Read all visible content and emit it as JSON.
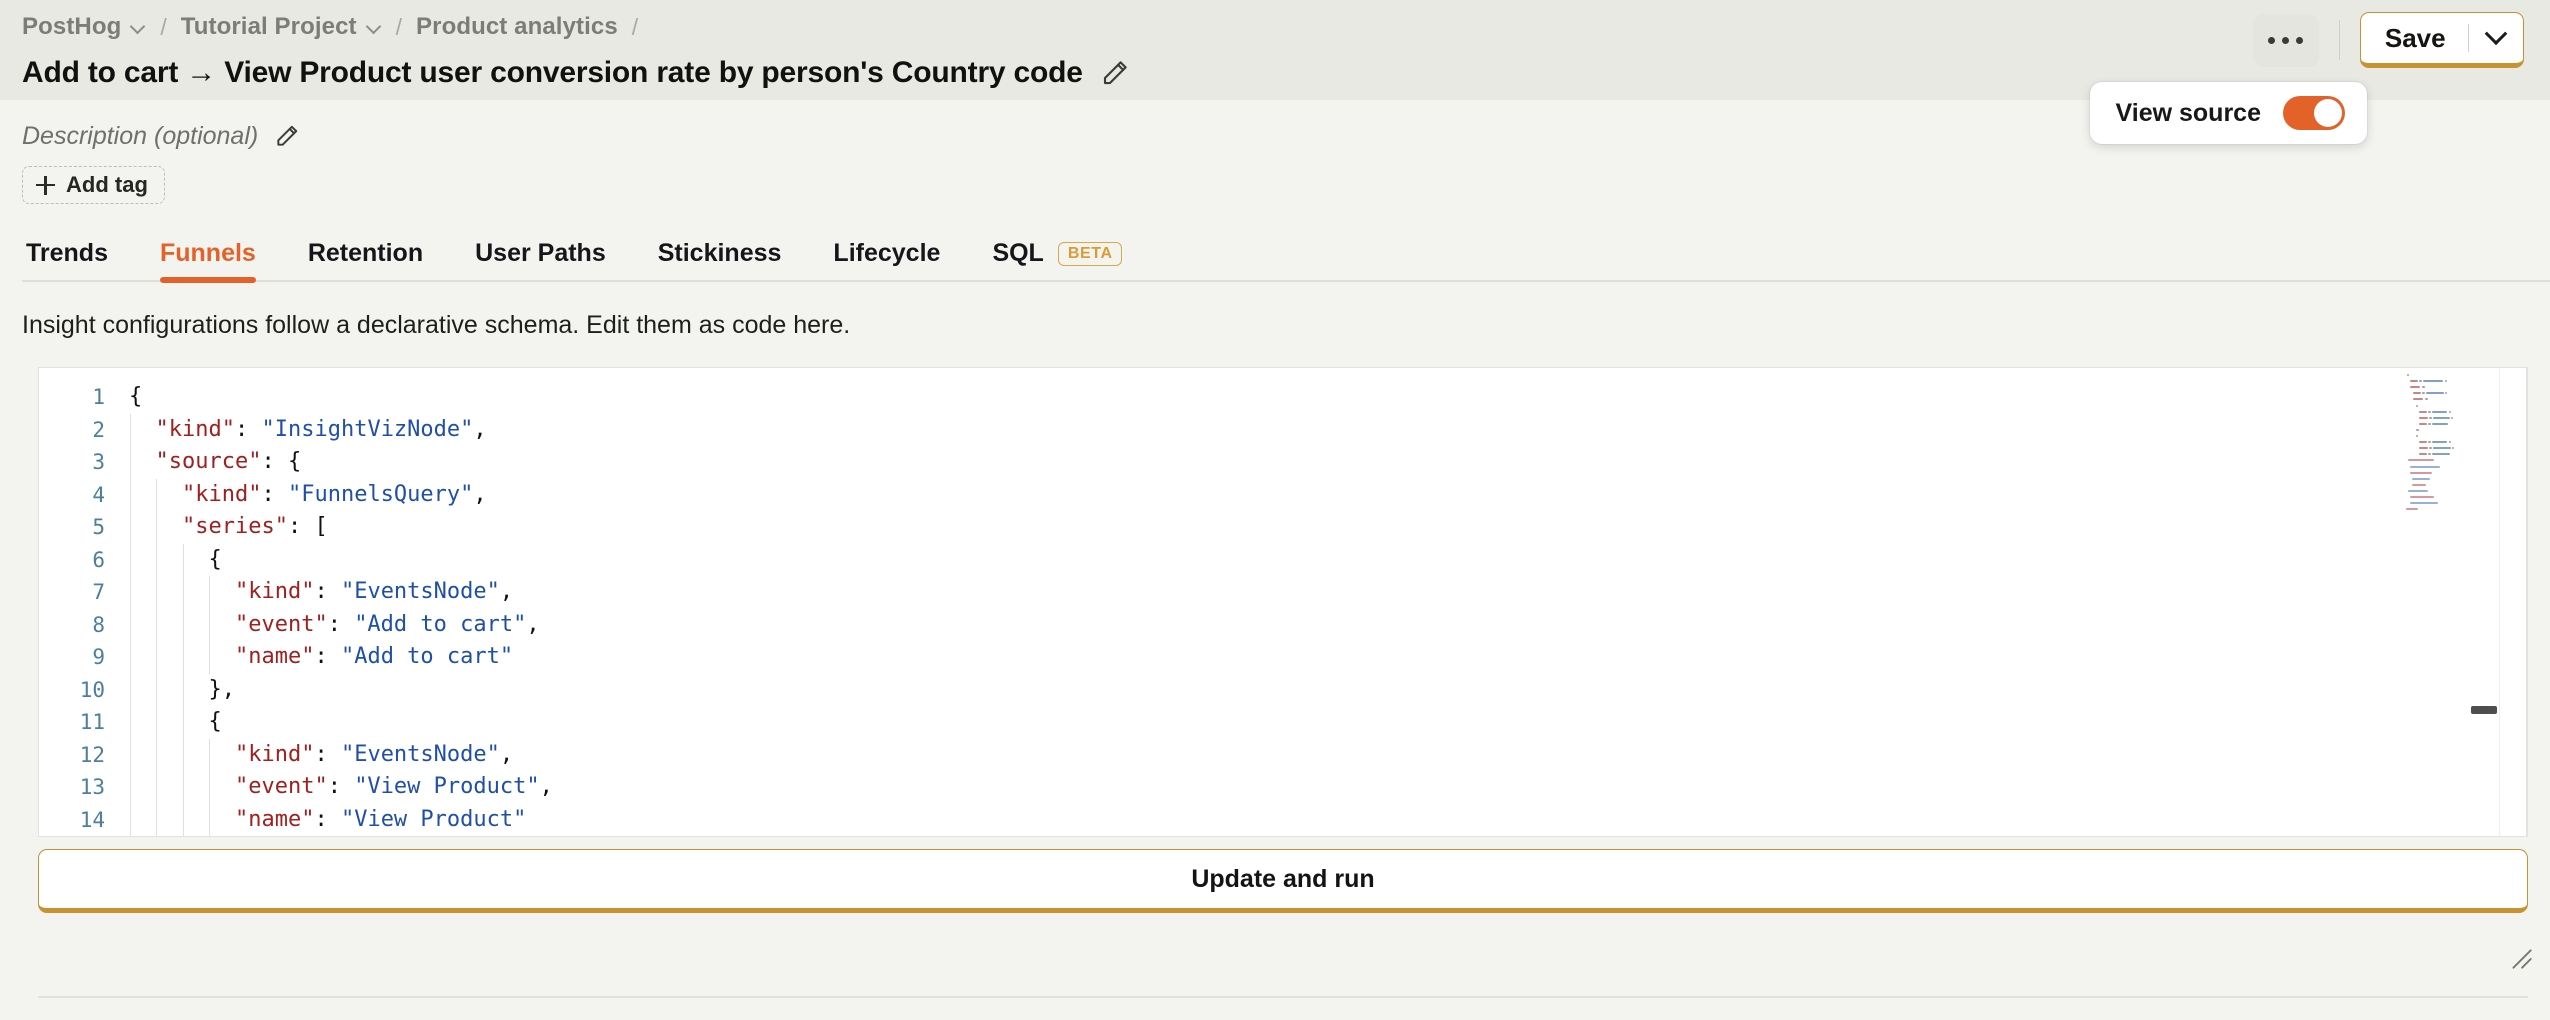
{
  "header": {
    "breadcrumb": [
      {
        "label": "PostHog",
        "has_chevron": true
      },
      {
        "label": "Tutorial Project",
        "has_chevron": true
      },
      {
        "label": "Product analytics",
        "has_chevron": false
      }
    ],
    "separator": "/",
    "title": "Add to cart → View Product user conversion rate by person's Country code",
    "edit_title_icon": "pencil-icon",
    "more_menu_icon": "ellipsis-icon",
    "save_label": "Save",
    "save_caret_icon": "chevron-down-icon"
  },
  "view_source_popover": {
    "label": "View source",
    "toggle_on": true,
    "accent": "#e3622a"
  },
  "meta": {
    "description_placeholder": "Description (optional)",
    "description_edit_icon": "pencil-icon",
    "add_tag_label": "Add tag",
    "add_tag_icon": "plus-icon"
  },
  "tabs": [
    {
      "label": "Trends",
      "active": false,
      "badge": null
    },
    {
      "label": "Funnels",
      "active": true,
      "badge": null
    },
    {
      "label": "Retention",
      "active": false,
      "badge": null
    },
    {
      "label": "User Paths",
      "active": false,
      "badge": null
    },
    {
      "label": "Stickiness",
      "active": false,
      "badge": null
    },
    {
      "label": "Lifecycle",
      "active": false,
      "badge": null
    },
    {
      "label": "SQL",
      "active": false,
      "badge": "BETA"
    }
  ],
  "editor": {
    "hint": "Insight configurations follow a declarative schema. Edit them as code here.",
    "line_numbers": [
      1,
      2,
      3,
      4,
      5,
      6,
      7,
      8,
      9,
      10,
      11,
      12,
      13,
      14
    ],
    "lines": [
      {
        "n": 1,
        "indent": 0,
        "tokens": [
          {
            "t": "punct",
            "v": "{"
          }
        ]
      },
      {
        "n": 2,
        "indent": 1,
        "tokens": [
          {
            "t": "key",
            "v": "\"kind\""
          },
          {
            "t": "punct",
            "v": ": "
          },
          {
            "t": "str",
            "v": "\"InsightVizNode\""
          },
          {
            "t": "punct",
            "v": ","
          }
        ]
      },
      {
        "n": 3,
        "indent": 1,
        "tokens": [
          {
            "t": "key",
            "v": "\"source\""
          },
          {
            "t": "punct",
            "v": ": {"
          }
        ]
      },
      {
        "n": 4,
        "indent": 2,
        "tokens": [
          {
            "t": "key",
            "v": "\"kind\""
          },
          {
            "t": "punct",
            "v": ": "
          },
          {
            "t": "str",
            "v": "\"FunnelsQuery\""
          },
          {
            "t": "punct",
            "v": ","
          }
        ]
      },
      {
        "n": 5,
        "indent": 2,
        "tokens": [
          {
            "t": "key",
            "v": "\"series\""
          },
          {
            "t": "punct",
            "v": ": ["
          }
        ]
      },
      {
        "n": 6,
        "indent": 3,
        "tokens": [
          {
            "t": "punct",
            "v": "{"
          }
        ]
      },
      {
        "n": 7,
        "indent": 4,
        "tokens": [
          {
            "t": "key",
            "v": "\"kind\""
          },
          {
            "t": "punct",
            "v": ": "
          },
          {
            "t": "str",
            "v": "\"EventsNode\""
          },
          {
            "t": "punct",
            "v": ","
          }
        ]
      },
      {
        "n": 8,
        "indent": 4,
        "tokens": [
          {
            "t": "key",
            "v": "\"event\""
          },
          {
            "t": "punct",
            "v": ": "
          },
          {
            "t": "str",
            "v": "\"Add to cart\""
          },
          {
            "t": "punct",
            "v": ","
          }
        ]
      },
      {
        "n": 9,
        "indent": 4,
        "tokens": [
          {
            "t": "key",
            "v": "\"name\""
          },
          {
            "t": "punct",
            "v": ": "
          },
          {
            "t": "str",
            "v": "\"Add to cart\""
          }
        ]
      },
      {
        "n": 10,
        "indent": 3,
        "tokens": [
          {
            "t": "punct",
            "v": "},"
          }
        ]
      },
      {
        "n": 11,
        "indent": 3,
        "tokens": [
          {
            "t": "punct",
            "v": "{"
          }
        ]
      },
      {
        "n": 12,
        "indent": 4,
        "tokens": [
          {
            "t": "key",
            "v": "\"kind\""
          },
          {
            "t": "punct",
            "v": ": "
          },
          {
            "t": "str",
            "v": "\"EventsNode\""
          },
          {
            "t": "punct",
            "v": ","
          }
        ]
      },
      {
        "n": 13,
        "indent": 4,
        "tokens": [
          {
            "t": "key",
            "v": "\"event\""
          },
          {
            "t": "punct",
            "v": ": "
          },
          {
            "t": "str",
            "v": "\"View Product\""
          },
          {
            "t": "punct",
            "v": ","
          }
        ]
      },
      {
        "n": 14,
        "indent": 4,
        "tokens": [
          {
            "t": "key",
            "v": "\"name\""
          },
          {
            "t": "punct",
            "v": ": "
          },
          {
            "t": "str",
            "v": "\"View Product\""
          }
        ]
      }
    ],
    "minimap_visible": true,
    "update_run_label": "Update and run",
    "resize_handle_icon": "resize-grip-icon"
  },
  "colors": {
    "accent_orange": "#e3622a",
    "button_gold": "#c79230",
    "header_bg": "#e8e9e3",
    "page_bg": "#f3f3ef",
    "json_key": "#a02020",
    "json_string": "#1f4fa8",
    "line_number": "#4b7f9c"
  }
}
